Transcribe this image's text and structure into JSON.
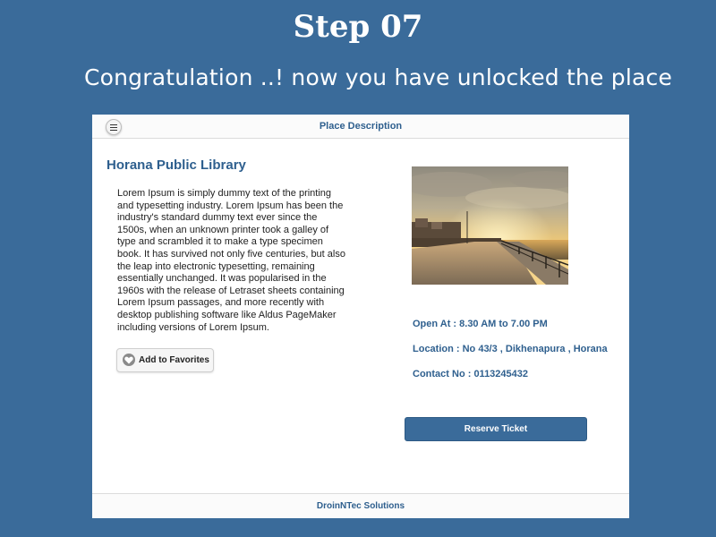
{
  "slide": {
    "step_title": "Step 07",
    "message": "Congratulation ..! now you have unlocked the place",
    "background_color": "#3a6b9a"
  },
  "app": {
    "header": {
      "menu_icon": "hamburger-menu-icon",
      "title": "Place Description"
    },
    "place": {
      "name": "Horana Public Library",
      "description": "Lorem Ipsum is simply dummy text of the printing and typesetting industry. Lorem Ipsum has been the industry's standard dummy text ever since the 1500s, when an unknown printer took a galley of type and scrambled it to make a type specimen book. It has survived not only five centuries, but also the leap into electronic typesetting, remaining essentially unchanged. It was popularised in the 1960s with the release of Letraset sheets containing Lorem Ipsum passages, and more recently with desktop publishing software like Aldus PageMaker including versions of Lorem Ipsum.",
      "open_at": "Open At : 8.30 AM to 7.00 PM",
      "location": "Location : No 43/3 , Dikhenapura , Horana",
      "contact": "Contact No : 0113245432"
    },
    "buttons": {
      "add_favorites": "Add to Favorites",
      "favorites_icon": "heart-icon",
      "reserve_ticket": "Reserve Ticket"
    },
    "footer": {
      "text": "DroinNTec Solutions"
    },
    "colors": {
      "accent": "#2e5f8e",
      "button": "#3a6b9a"
    }
  }
}
